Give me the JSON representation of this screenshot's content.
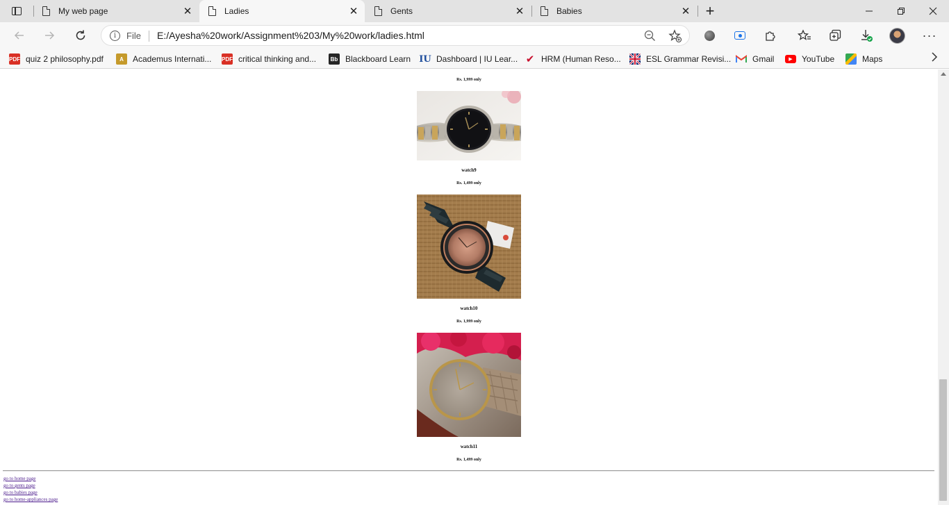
{
  "browser": {
    "tabs": [
      {
        "title": "My web page",
        "active": false
      },
      {
        "title": "Ladies",
        "active": true
      },
      {
        "title": "Gents",
        "active": false
      },
      {
        "title": "Babies",
        "active": false
      }
    ],
    "address": {
      "scheme_label": "File",
      "url": "E:/Ayesha%20work/Assignment%203/My%20work/ladies.html"
    },
    "bookmarks": [
      {
        "label": "quiz 2 philosophy.pdf",
        "icon": "pdf-icon",
        "color": "#d93025"
      },
      {
        "label": "Academus Internati...",
        "icon": "academus-icon",
        "color": "#c59a2b"
      },
      {
        "label": "critical thinking and...",
        "icon": "pdf-icon",
        "color": "#d93025"
      },
      {
        "label": "Blackboard Learn",
        "icon": "blackboard-icon",
        "color": "#262626"
      },
      {
        "label": "Dashboard | IU Lear...",
        "icon": "iu-icon",
        "color": "#1f4e9c"
      },
      {
        "label": "HRM (Human Reso...",
        "icon": "hrm-icon",
        "color": "#c8102e"
      },
      {
        "label": "ESL Grammar Revisi...",
        "icon": "uk-flag-icon",
        "color": "#012169"
      },
      {
        "label": "Gmail",
        "icon": "gmail-icon",
        "color": "#ea4335"
      },
      {
        "label": "YouTube",
        "icon": "youtube-icon",
        "color": "#ff0000"
      },
      {
        "label": "Maps",
        "icon": "maps-icon",
        "color": "#34a853"
      }
    ]
  },
  "page": {
    "top_price": "Rs. 1,999 only",
    "products": [
      {
        "name": "watch9",
        "price": "Rs. 1,499 only",
        "image": "watch-black-gold-bracelet"
      },
      {
        "name": "watch10",
        "price": "Rs. 1,999 only",
        "image": "watch-black-rose-gold-strap"
      },
      {
        "name": "watch11",
        "price": "Rs. 1,499 only",
        "image": "watch-beige-leather-strap"
      }
    ],
    "footer_links": [
      "go to home page",
      "go to gents page",
      "go to babies page",
      "go to home-appliances page"
    ]
  }
}
